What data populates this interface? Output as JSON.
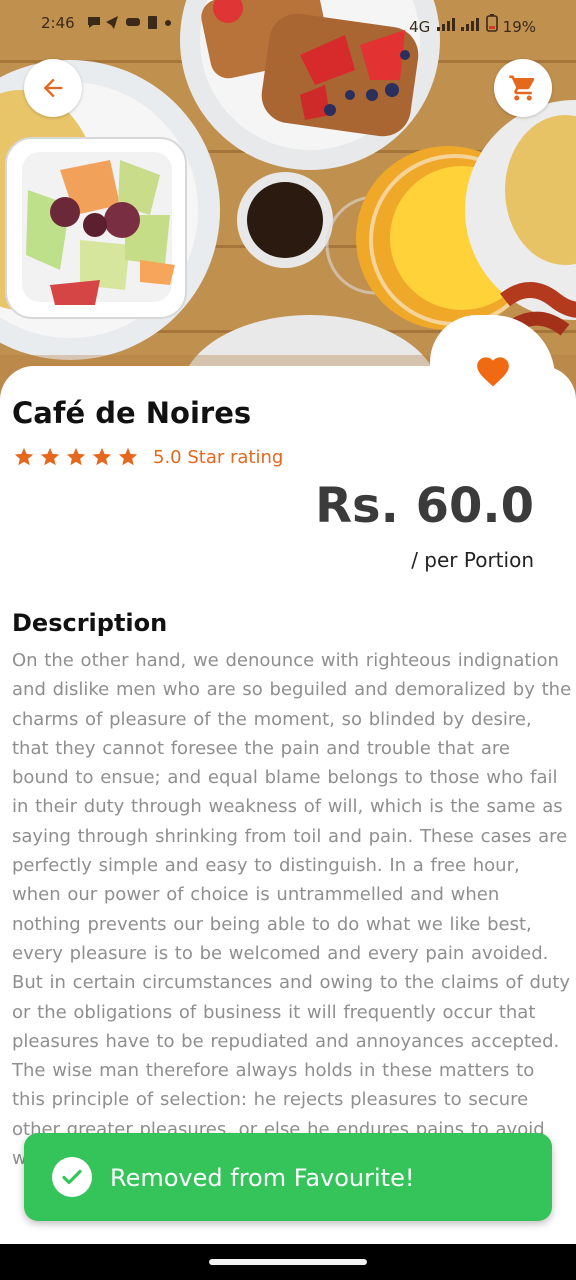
{
  "status_bar": {
    "time": "2:46",
    "network": "4G",
    "battery": "19%"
  },
  "product": {
    "name": "Café de Noires",
    "rating_text": "5.0 Star rating",
    "rating_value": 5,
    "price": "Rs. 60.0",
    "unit": "/ per Portion"
  },
  "description": {
    "heading": "Description",
    "body": "On the other hand, we denounce with righteous indignation and dislike men who are so beguiled and demoralized by the charms of pleasure of the moment, so blinded by desire, that they cannot foresee the pain and trouble that are bound to ensue; and equal blame belongs to those who fail in their duty through weakness of will, which is the same as saying through shrinking from toil and pain. These cases are perfectly simple and easy to distinguish. In a free hour, when our power of choice is untrammelled and when nothing prevents our being able to do what we like best, every pleasure is to be welcomed and every pain avoided. But in certain circumstances and owing to the claims of duty or the obligations of business it will frequently occur that pleasures have to be repudiated and annoyances accepted. The wise man therefore always holds in these matters to this principle of selection: he rejects pleasures to secure other greater pleasures, or else he endures pains to avoid worse pains."
  },
  "toast": {
    "message": "Removed from Favourite!"
  },
  "icons": {
    "back": "arrow-left-icon",
    "cart": "cart-icon",
    "favourite": "heart-icon",
    "star": "star-icon",
    "toast": "check-circle-icon"
  },
  "colors": {
    "accent": "#e6671e",
    "toast_bg": "#34c45a",
    "price_text": "#3b3b3b",
    "description_text": "#8f8f8f"
  }
}
